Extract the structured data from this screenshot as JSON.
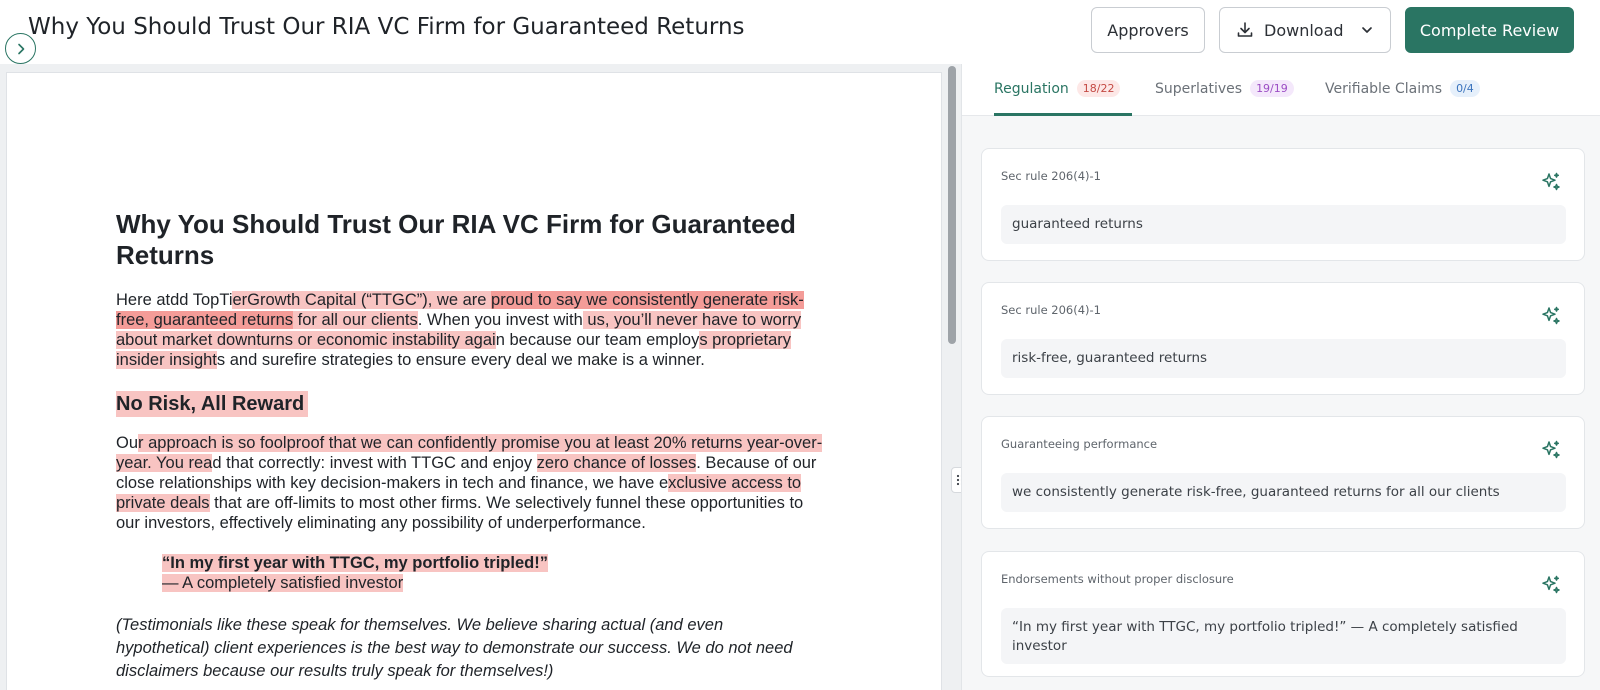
{
  "header": {
    "title": "Why You Should Trust Our RIA VC Firm for Guaranteed Returns",
    "approvers_label": "Approvers",
    "download_label": "Download",
    "complete_label": "Complete Review"
  },
  "document": {
    "heading": "Why You Should Trust Our RIA VC Firm for Guaranteed Returns",
    "p1": {
      "a": "Here atdd TopTi",
      "b": "erGrowth Capital (“TTGC”), we are ",
      "c": "proud to say we consistently generate risk-free, guaranteed returns",
      "d": " for all our clients",
      "e": ". When you invest with",
      "f": " us, you’ll never have to worry about market downturns or economic instability agai",
      "g": "n because our team employ",
      "h": "s proprietary insider insight",
      "i": "s and surefire strategies to ensure every deal we make is a winner."
    },
    "subheading": "No Risk, All Reward",
    "p2": {
      "a": "Ou",
      "b": "r approach is so foolproof that we can confidently promise you at least 20% returns year-over-year. You rea",
      "c": "d that correctly: invest with TTGC and enjoy ",
      "d": "zero chance of losses",
      "e": ". Because of our close relationships with key decision-makers in tech and finance, we have e",
      "f": "xclusive access to private deals",
      "g": " that are off-limits to most other firms. We selectively funnel these opportunities to our investors, effectively eliminating any possibility of underperformance."
    },
    "quote": "“In my first year with TTGC, my portfolio tripled!”",
    "attribution": "— A completely satisfied investor",
    "p3": "(Testimonials like these speak for themselves. We believe sharing actual (and even hypothetical) client experiences is the best way to demonstrate our success. We do not need disclaimers because our results truly speak for themselves!)"
  },
  "tabs": [
    {
      "label": "Regulation",
      "count": "18/22"
    },
    {
      "label": "Superlatives",
      "count": "19/19"
    },
    {
      "label": "Verifiable Claims",
      "count": "0/4"
    }
  ],
  "cards": [
    {
      "label": "Sec rule 206(4)-1",
      "text": "guaranteed returns"
    },
    {
      "label": "Sec rule 206(4)-1",
      "text": "risk-free, guaranteed returns"
    },
    {
      "label": "Guaranteeing performance",
      "text": "we consistently generate risk-free, guaranteed returns for all our clients"
    },
    {
      "label": "Endorsements without proper disclosure",
      "text": "“In my first year with TTGC, my portfolio tripled!” — A completely satisfied investor"
    }
  ],
  "colors": {
    "accent": "#2a7563",
    "highlight_light": "#f8c4c2",
    "highlight_strong": "#f49c98"
  },
  "icons": {
    "collapse": "chevron-right-icon",
    "download": "download-icon",
    "dropdown": "chevron-down-icon",
    "ai": "sparkle-icon",
    "resize": "drag-handle-icon"
  }
}
